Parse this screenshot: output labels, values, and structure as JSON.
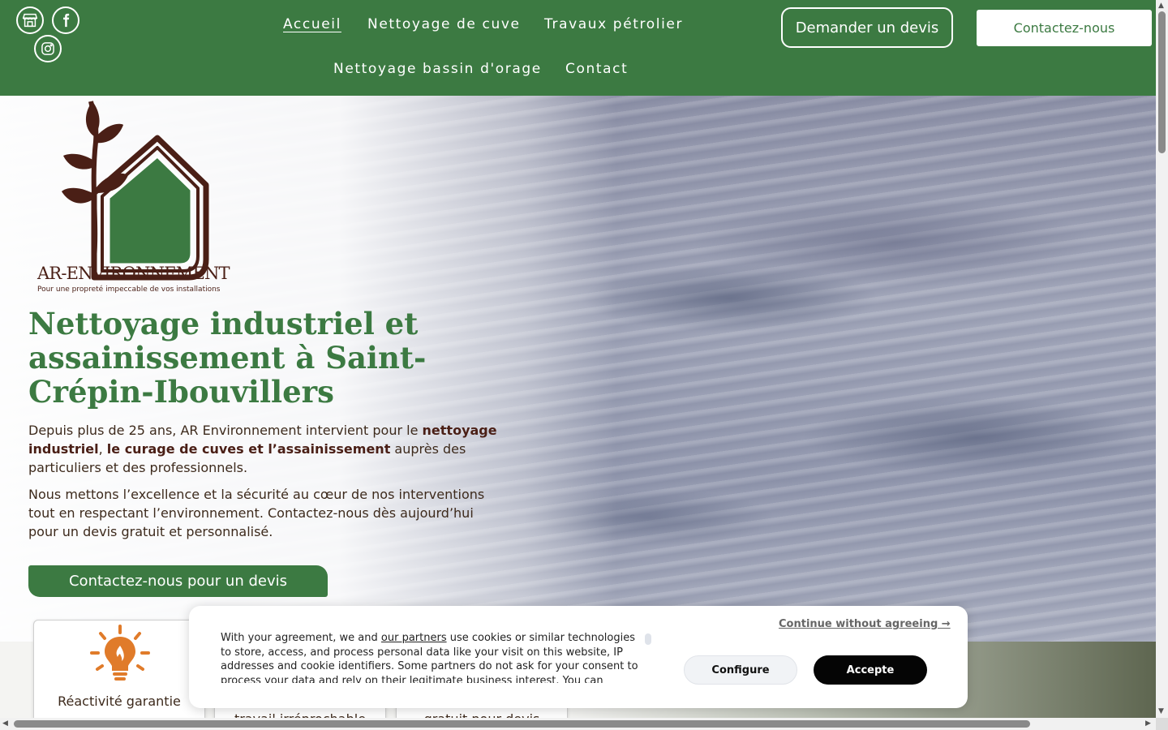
{
  "header": {
    "nav": {
      "home": "Accueil",
      "tank_cleaning": "Nettoyage de cuve",
      "petroleum_works": "Travaux pétrolier",
      "storm_basin": "Nettoyage bassin d'orage",
      "contact": "Contact"
    },
    "quote_button": "Demander un devis",
    "contact_button": "Contactez-nous",
    "social_icons": [
      "store-icon",
      "facebook-icon",
      "instagram-icon"
    ]
  },
  "logo": {
    "name": "AR-ENVIRONNEMENT",
    "tagline": "Pour une propreté impeccable de vos installations"
  },
  "hero": {
    "title": "Nettoyage industriel et assainissement à Saint-Crépin-Ibouvillers",
    "p1_start": "Depuis plus de 25 ans, AR Environnement intervient pour le ",
    "p1_bold1": "nettoyage industriel",
    "p1_mid": ", ",
    "p1_bold2": "le curage de cuves et l’assainissement",
    "p1_end": " auprès des particuliers et des professionnels.",
    "p2": "Nous mettons l’excellence et la sécurité au cœur de nos interventions tout en respectant l’environnement. Contactez-nous dès aujourd’hui pour un devis gratuit et personnalisé.",
    "cta": "Contactez-nous pour un devis"
  },
  "features": [
    {
      "label": "Réactivité garantie",
      "icon": "lightbulb-icon"
    },
    {
      "label": "travail irréprochable"
    },
    {
      "label": "gratuit pour devis"
    }
  ],
  "cookie": {
    "text_before": "With your agreement, we and ",
    "partners_link": "our partners",
    "text_after": " use cookies or similar technologies to store, access, and process personal data like your visit on this website, IP addresses and cookie identifiers. Some partners do not ask for your consent to process your data and rely on their legitimate business interest. You can",
    "continue": "Continue without agreeing →",
    "configure": "Configure",
    "accept": "Accepte"
  },
  "colors": {
    "brand_green": "#3c7a42",
    "brand_brown": "#4a1f16",
    "accent_orange": "#e07b2a"
  }
}
